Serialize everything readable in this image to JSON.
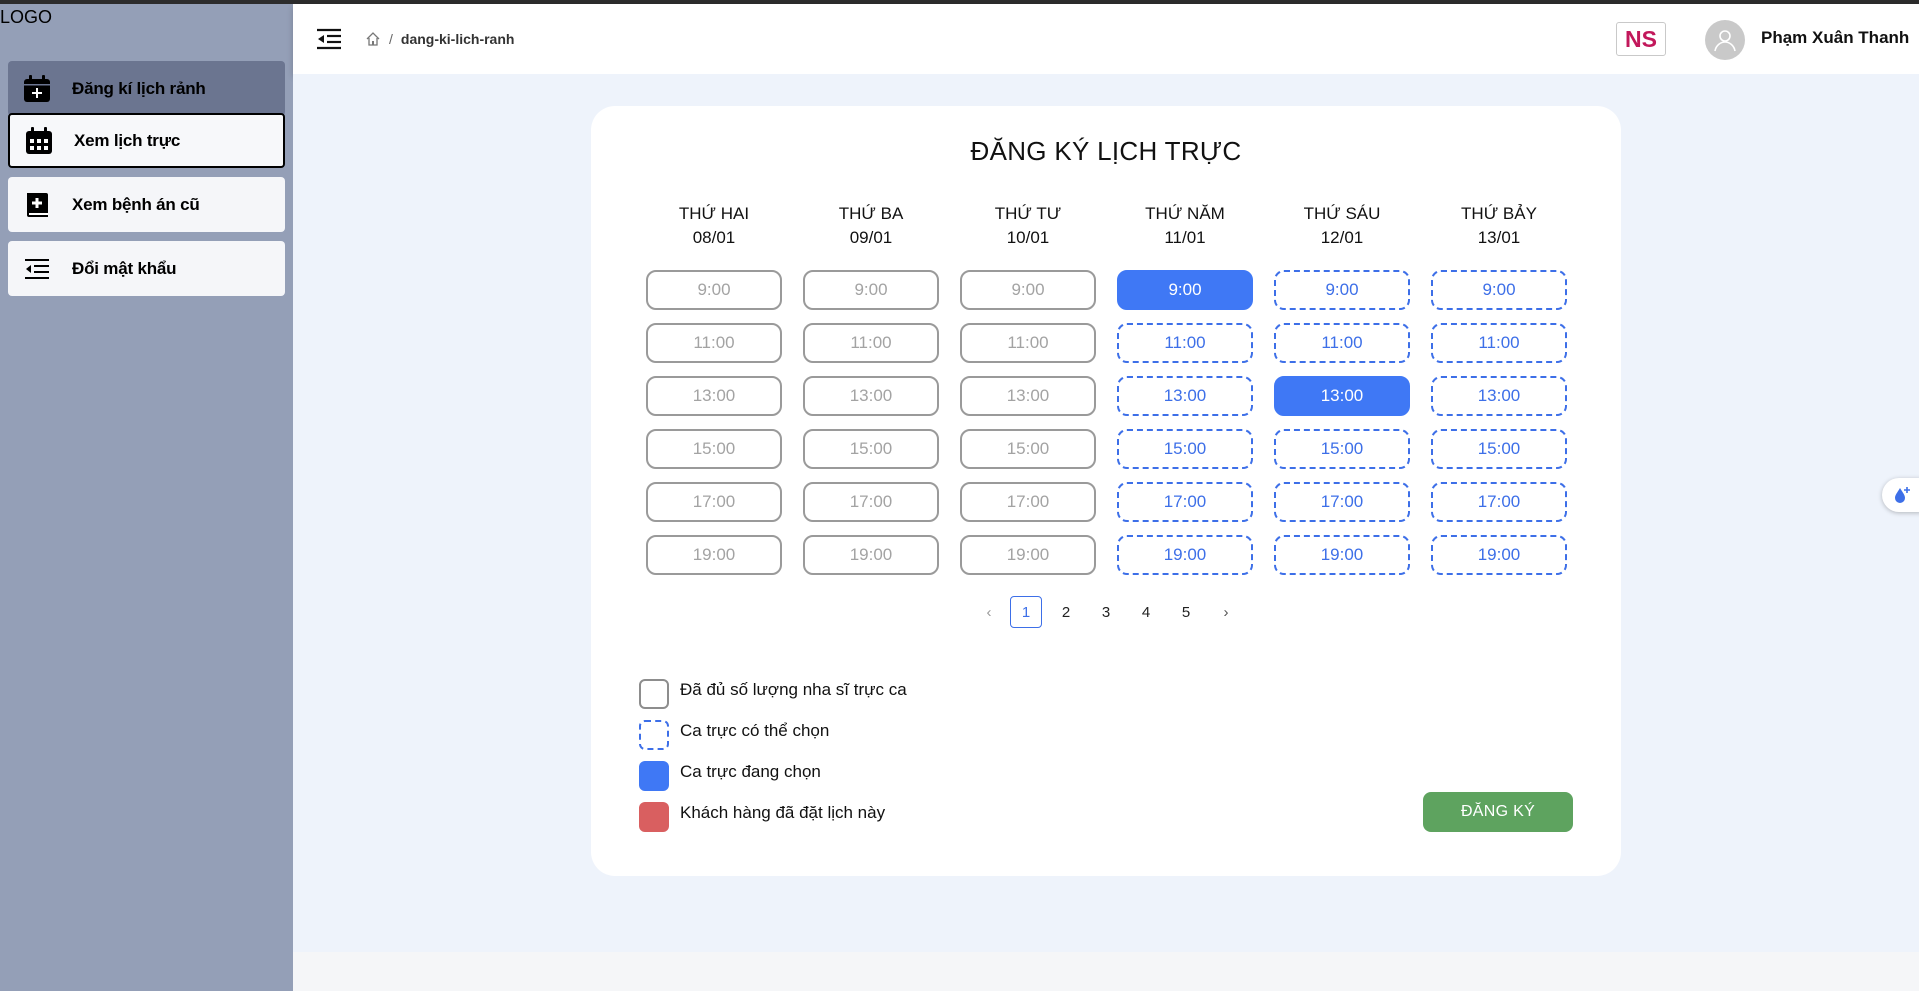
{
  "logo": "LOGO",
  "sidebar": {
    "items": [
      {
        "label": "Đăng kí lịch rảnh",
        "icon": "calendar-plus-icon"
      },
      {
        "label": "Xem lịch trực",
        "icon": "calendar-grid-icon"
      },
      {
        "label": "Xem bệnh án cũ",
        "icon": "medical-book-icon"
      },
      {
        "label": "Đổi mật khẩu",
        "icon": "indent-list-icon"
      }
    ]
  },
  "header": {
    "breadcrumb_sep": "/",
    "breadcrumb_current": "dang-ki-lich-ranh",
    "badge": "NS",
    "username": "Phạm Xuân Thanh"
  },
  "schedule": {
    "title": "ĐĂNG KÝ LỊCH TRỰC",
    "days": [
      {
        "name": "THỨ HAI",
        "date": "08/01"
      },
      {
        "name": "THỨ BA",
        "date": "09/01"
      },
      {
        "name": "THỨ TƯ",
        "date": "10/01"
      },
      {
        "name": "THỨ NĂM",
        "date": "11/01"
      },
      {
        "name": "THỨ SÁU",
        "date": "12/01"
      },
      {
        "name": "THỨ BẢY",
        "date": "13/01"
      }
    ],
    "times": [
      "9:00",
      "11:00",
      "13:00",
      "15:00",
      "17:00",
      "19:00"
    ],
    "slot_states": [
      [
        "full",
        "full",
        "full",
        "full",
        "full",
        "full"
      ],
      [
        "full",
        "full",
        "full",
        "full",
        "full",
        "full"
      ],
      [
        "full",
        "full",
        "full",
        "full",
        "full",
        "full"
      ],
      [
        "selected",
        "available",
        "available",
        "available",
        "available",
        "available"
      ],
      [
        "available",
        "available",
        "selected",
        "available",
        "available",
        "available"
      ],
      [
        "available",
        "available",
        "available",
        "available",
        "available",
        "available"
      ]
    ]
  },
  "pagination": {
    "prev": "‹",
    "next": "›",
    "pages": [
      "1",
      "2",
      "3",
      "4",
      "5"
    ],
    "current": "1"
  },
  "legend": [
    {
      "kind": "full",
      "label": "Đã đủ số lượng nha sĩ trực ca"
    },
    {
      "kind": "avail",
      "label": "Ca trực có thể chọn"
    },
    {
      "kind": "sel",
      "label": "Ca trực đang chọn"
    },
    {
      "kind": "booked",
      "label": "Khách hàng đã đặt lịch này"
    }
  ],
  "submit_label": "ĐĂNG KÝ",
  "colors": {
    "selected": "#3f78f5",
    "available": "#3d6fe8",
    "booked": "#d95f60",
    "submit": "#5ea35f",
    "sidebar": "#949fb7"
  }
}
